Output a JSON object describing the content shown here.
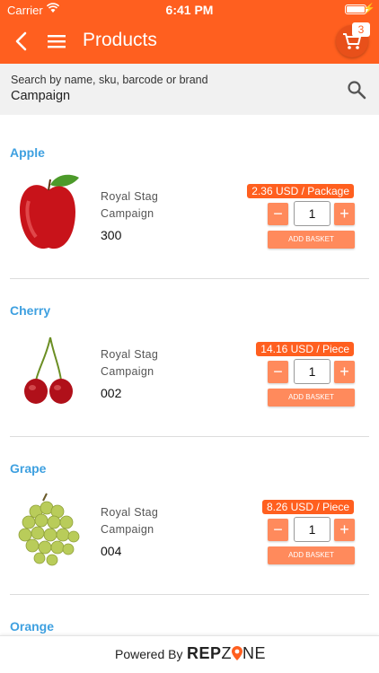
{
  "status_bar": {
    "carrier": "Carrier",
    "time": "6:41 PM"
  },
  "header": {
    "title": "Products",
    "cart_count": "3"
  },
  "search": {
    "placeholder": "Search by name, sku, barcode or brand",
    "value": "Campaign"
  },
  "products": [
    {
      "name": "Apple",
      "brand": "Royal Stag",
      "campaign": "Campaign",
      "code": "300",
      "price": "2.36 USD / Package",
      "quantity": "1",
      "add_label": "ADD BASKET"
    },
    {
      "name": "Cherry",
      "brand": "Royal Stag",
      "campaign": "Campaign",
      "code": "002",
      "price": "14.16 USD / Piece",
      "quantity": "1",
      "add_label": "ADD BASKET"
    },
    {
      "name": "Grape",
      "brand": "Royal Stag",
      "campaign": "Campaign",
      "code": "004",
      "price": "8.26 USD / Piece",
      "quantity": "1",
      "add_label": "ADD BASKET"
    },
    {
      "name": "Orange"
    }
  ],
  "footer": {
    "powered_by": "Powered By",
    "logo_rep": "REP",
    "logo_z": "Z",
    "logo_one": "NE"
  },
  "icons": {
    "back": "back-arrow-icon",
    "menu": "hamburger-menu-icon",
    "cart": "shopping-cart-icon",
    "search": "search-icon",
    "minus": "minus",
    "plus": "plus"
  },
  "colors": {
    "primary": "#ff5f1f",
    "accent_button": "#ff8a5c",
    "product_name": "#3ea0e0"
  }
}
